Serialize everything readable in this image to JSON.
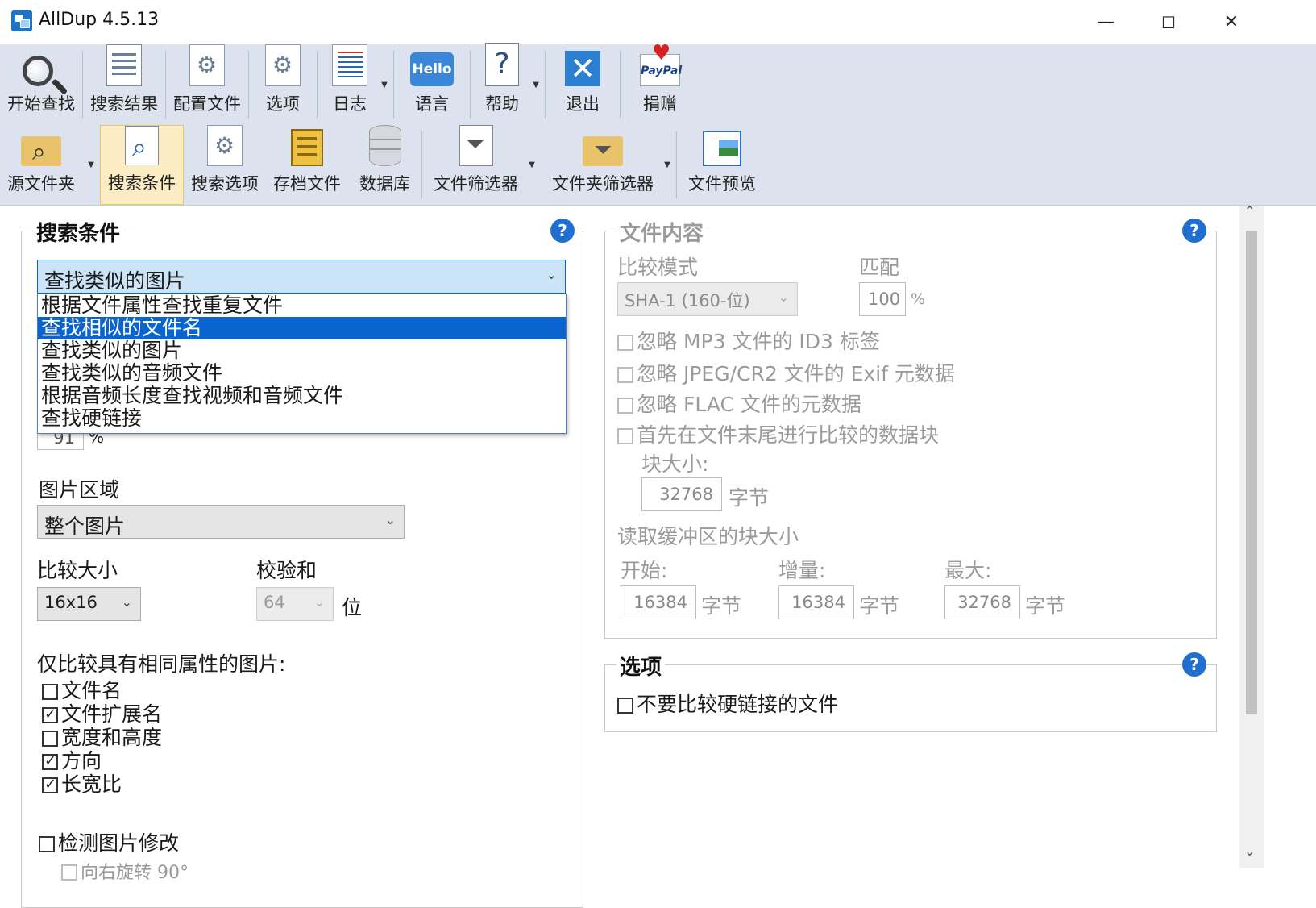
{
  "window": {
    "title": "AllDup 4.5.13",
    "min": "—",
    "max": "☐",
    "close": "✕"
  },
  "toolbar1": [
    {
      "label": "开始查找",
      "icon": "magnifier-icon"
    },
    {
      "label": "搜索结果",
      "icon": "results-icon"
    },
    {
      "label": "配置文件",
      "icon": "profile-icon"
    },
    {
      "label": "选项",
      "icon": "options-icon"
    },
    {
      "label": "日志",
      "icon": "log-icon"
    },
    {
      "label": "语言",
      "icon": "hello-icon",
      "badge": "Hello"
    },
    {
      "label": "帮助",
      "icon": "help-icon",
      "glyph": "?"
    },
    {
      "label": "退出",
      "icon": "exit-icon",
      "glyph": "✕"
    },
    {
      "label": "捐赠",
      "icon": "paypal-icon",
      "badge": "PayPal"
    }
  ],
  "toolbar2": [
    {
      "label": "源文件夹",
      "icon": "source-folder-icon"
    },
    {
      "label": "搜索条件",
      "icon": "search-criteria-icon"
    },
    {
      "label": "搜索选项",
      "icon": "search-options-icon"
    },
    {
      "label": "存档文件",
      "icon": "archive-icon"
    },
    {
      "label": "数据库",
      "icon": "database-icon"
    },
    {
      "label": "文件筛选器",
      "icon": "file-filter-icon"
    },
    {
      "label": "文件夹筛选器",
      "icon": "folder-filter-icon"
    },
    {
      "label": "文件预览",
      "icon": "file-preview-icon"
    }
  ],
  "left": {
    "title": "搜索条件",
    "method_selected": "查找类似的图片",
    "method_options": [
      "根据文件属性查找重复文件",
      "查找相似的文件名",
      "查找类似的图片",
      "查找类似的音频文件",
      "根据音频长度查找视频和音频文件",
      "查找硬链接"
    ],
    "highlighted_index": 1,
    "similarity_value": "91",
    "similarity_unit": "%",
    "region_label": "图片区域",
    "region_value": "整个图片",
    "compare_size_label": "比较大小",
    "compare_size_value": "16x16",
    "checksum_label": "校验和",
    "checksum_value": "64",
    "checksum_unit": "位",
    "same_attr_label": "仅比较具有相同属性的图片:",
    "attrs": [
      {
        "label": "文件名",
        "checked": false
      },
      {
        "label": "文件扩展名",
        "checked": true
      },
      {
        "label": "宽度和高度",
        "checked": false
      },
      {
        "label": "方向",
        "checked": true
      },
      {
        "label": "长宽比",
        "checked": true
      }
    ],
    "detect_mod_label": "检测图片修改",
    "rotate_partial": "向右旋转 90°"
  },
  "right": {
    "content_title": "文件内容",
    "compare_mode_label": "比较模式",
    "compare_mode_value": "SHA-1 (160-位)",
    "match_label": "匹配",
    "match_value": "100",
    "match_unit": "%",
    "checks": [
      "忽略 MP3 文件的 ID3 标签",
      "忽略 JPEG/CR2 文件的 Exif 元数据",
      "忽略 FLAC 文件的元数据",
      "首先在文件末尾进行比较的数据块"
    ],
    "block_size_label": "块大小:",
    "block_size_value": "32768",
    "bytes": "字节",
    "buffer_label": "读取缓冲区的块大小",
    "start_label": "开始:",
    "start_value": "16384",
    "inc_label": "增量:",
    "inc_value": "16384",
    "max_label": "最大:",
    "max_value": "32768",
    "options_title": "选项",
    "hardlink_label": "不要比较硬链接的文件"
  }
}
